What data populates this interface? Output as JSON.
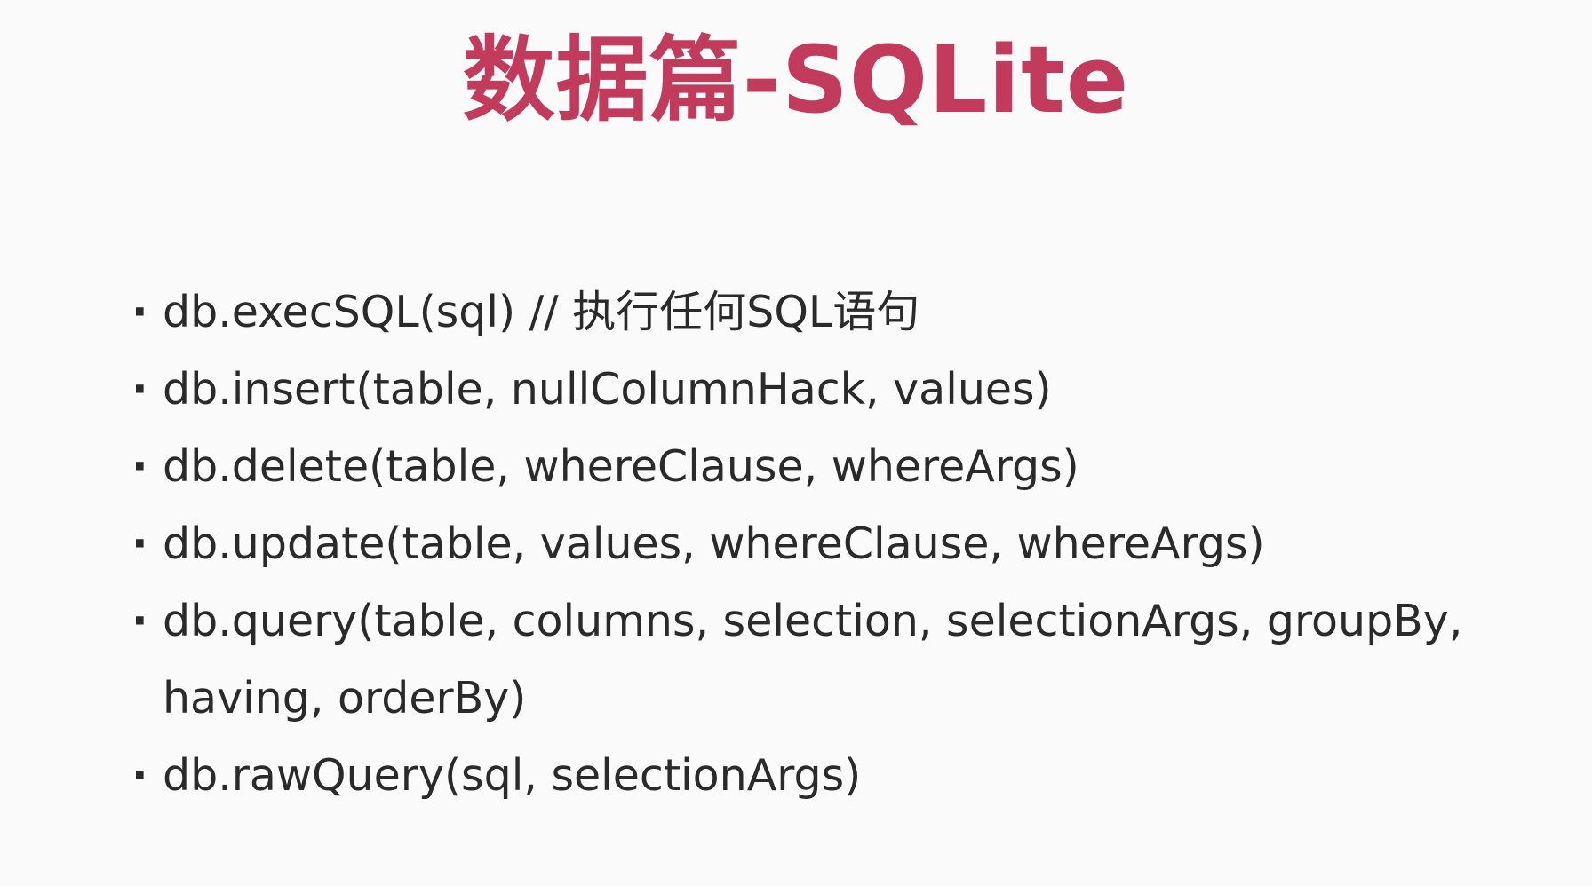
{
  "slide": {
    "title": "数据篇-SQLite",
    "title_color": "#c23a5c",
    "text_color": "#2a2a2a",
    "bullet_glyph": "·",
    "bullets": [
      {
        "text": "db.execSQL(sql) // 执行任何SQL语句"
      },
      {
        "text": "db.insert(table, nullColumnHack, values)"
      },
      {
        "text": "db.delete(table, whereClause, whereArgs)"
      },
      {
        "text": "db.update(table, values, whereClause, whereArgs)"
      },
      {
        "text": "db.query(table, columns, selection, selectionArgs, groupBy, having, orderBy)"
      },
      {
        "text": "db.rawQuery(sql, selectionArgs)"
      }
    ]
  }
}
